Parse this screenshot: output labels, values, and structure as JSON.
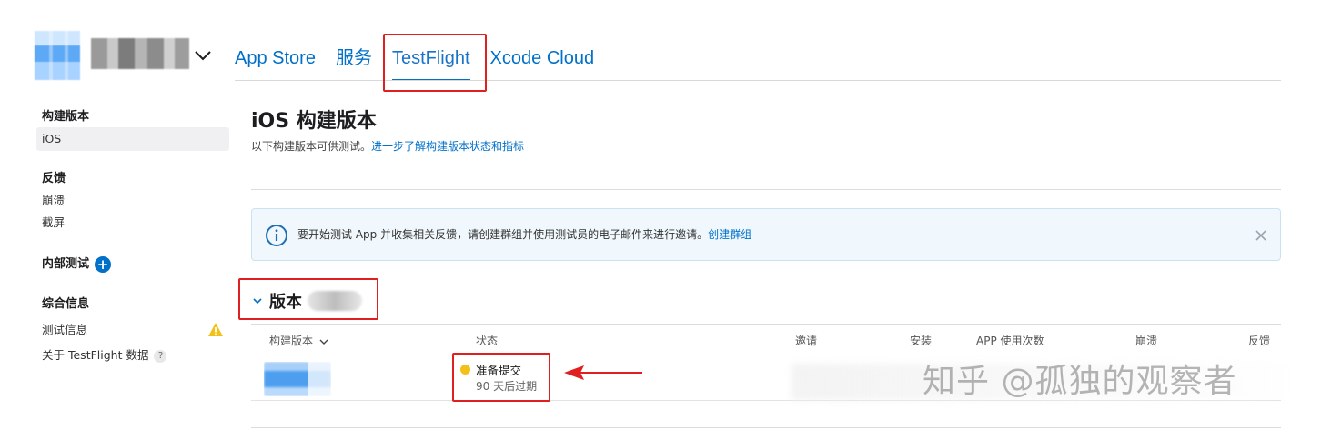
{
  "header": {
    "nav": [
      {
        "label": "App Store"
      },
      {
        "label": "服务"
      },
      {
        "label": "TestFlight",
        "active": true
      },
      {
        "label": "Xcode Cloud"
      }
    ]
  },
  "sidebar": {
    "builds": {
      "heading": "构建版本",
      "items": [
        {
          "label": "iOS",
          "selected": true
        }
      ]
    },
    "feedback": {
      "heading": "反馈",
      "items": [
        {
          "label": "崩溃"
        },
        {
          "label": "截屏"
        }
      ]
    },
    "internal": {
      "heading": "内部测试"
    },
    "general": {
      "heading": "综合信息",
      "items": [
        {
          "label": "测试信息",
          "icon": "warning-icon"
        },
        {
          "label": "关于 TestFlight 数据",
          "icon": "help-icon"
        }
      ]
    }
  },
  "main": {
    "title": "iOS 构建版本",
    "subtitle": "以下构建版本可供测试。",
    "subtitle_link": "进一步了解构建版本状态和指标",
    "banner": {
      "text": "要开始测试 App 并收集相关反馈，请创建群组并使用测试员的电子邮件来进行邀请。",
      "link": "创建群组"
    },
    "version_label": "版本",
    "table": {
      "columns": [
        "构建版本",
        "状态",
        "邀请",
        "安装",
        "APP 使用次数",
        "崩溃",
        "反馈"
      ],
      "rows": [
        {
          "status": "准备提交",
          "status_sub": "90 天后过期",
          "status_color": "#f3c018"
        }
      ]
    }
  },
  "watermark": "知乎 @孤独的观察者",
  "colors": {
    "accent": "#0070c9",
    "annotation": "#e02020",
    "warning": "#f3c018"
  }
}
